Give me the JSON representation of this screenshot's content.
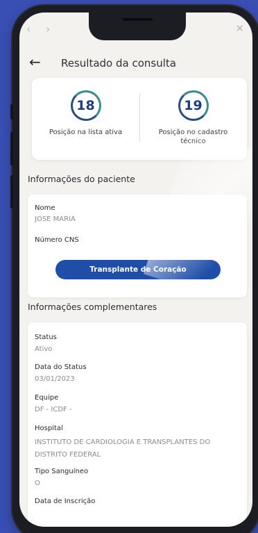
{
  "header": {
    "title": "Resultado da consulta"
  },
  "positions": [
    {
      "number": "18",
      "label": "Posição na lista ativa"
    },
    {
      "number": "19",
      "label": "Posição no cadastro técnico"
    }
  ],
  "patient": {
    "section_title": "Informações do paciente",
    "name_label": "Nome",
    "name_value": "JOSE MARIA",
    "cns_label": "Número CNS",
    "action_button": "Transplante de Coração"
  },
  "complementary": {
    "section_title": "Informações complementares",
    "fields": [
      {
        "label": "Status",
        "value": "Ativo"
      },
      {
        "label": "Data do Status",
        "value": "03/01/2023"
      },
      {
        "label": "Equipe",
        "value": "DF - ICDF -"
      },
      {
        "label": "Hospital",
        "value": "INSTITUTO DE CARDIOLOGIA E TRANSPLANTES DO DISTRITO FEDERAL"
      },
      {
        "label": "Tipo Sanguíneo",
        "value": "O"
      },
      {
        "label": "Data de Inscrição",
        "value": ""
      }
    ]
  },
  "colors": {
    "background": "#3a4fb4",
    "primary_button": "#1f4ea8",
    "circle_border": "#3b8c90"
  },
  "icons": {
    "back": "arrow-left-icon",
    "close": "close-icon",
    "nav_prev": "chevron-left-icon",
    "nav_next": "chevron-right-icon"
  }
}
